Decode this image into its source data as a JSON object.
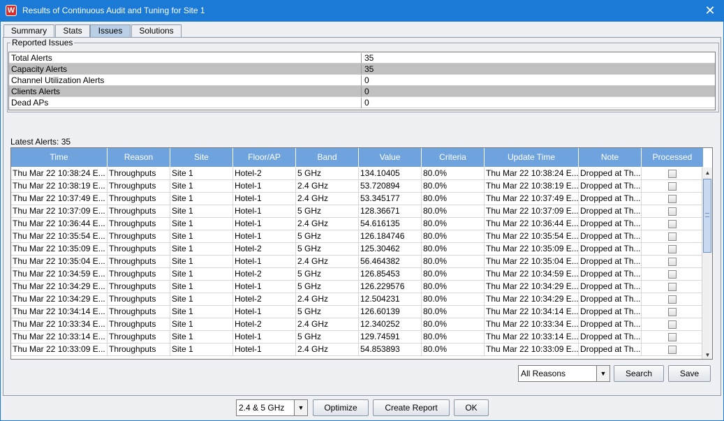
{
  "window": {
    "title": "Results of Continuous Audit and Tuning  for Site 1",
    "close_glyph": "✕"
  },
  "tabs": [
    "Summary",
    "Stats",
    "Issues",
    "Solutions"
  ],
  "active_tab": "Issues",
  "reported_issues": {
    "legend": "Reported Issues",
    "rows": [
      {
        "name": "Total Alerts",
        "value": "35"
      },
      {
        "name": "Capacity Alerts",
        "value": "35"
      },
      {
        "name": "Channel Utilization Alerts",
        "value": "0"
      },
      {
        "name": "Clients Alerts",
        "value": "0"
      },
      {
        "name": "Dead APs",
        "value": "0"
      }
    ]
  },
  "latest_alerts": {
    "label": "Latest Alerts: 35",
    "columns": [
      "Time",
      "Reason",
      "Site",
      "Floor/AP",
      "Band",
      "Value",
      "Criteria",
      "Update Time",
      "Note",
      "Processed"
    ],
    "rows": [
      [
        "Thu Mar 22 10:38:24 E...",
        "Throughputs",
        "Site 1",
        "Hotel-2",
        "5 GHz",
        "134.10405",
        "80.0%",
        "Thu Mar 22 10:38:24 E...",
        "Dropped at Th..."
      ],
      [
        "Thu Mar 22 10:38:19 E...",
        "Throughputs",
        "Site 1",
        "Hotel-1",
        "2.4 GHz",
        "53.720894",
        "80.0%",
        "Thu Mar 22 10:38:19 E...",
        "Dropped at Th..."
      ],
      [
        "Thu Mar 22 10:37:49 E...",
        "Throughputs",
        "Site 1",
        "Hotel-1",
        "2.4 GHz",
        "53.345177",
        "80.0%",
        "Thu Mar 22 10:37:49 E...",
        "Dropped at Th..."
      ],
      [
        "Thu Mar 22 10:37:09 E...",
        "Throughputs",
        "Site 1",
        "Hotel-1",
        "5 GHz",
        "128.36671",
        "80.0%",
        "Thu Mar 22 10:37:09 E...",
        "Dropped at Th..."
      ],
      [
        "Thu Mar 22 10:36:44 E...",
        "Throughputs",
        "Site 1",
        "Hotel-1",
        "2.4 GHz",
        "54.616135",
        "80.0%",
        "Thu Mar 22 10:36:44 E...",
        "Dropped at Th..."
      ],
      [
        "Thu Mar 22 10:35:54 E...",
        "Throughputs",
        "Site 1",
        "Hotel-1",
        "5 GHz",
        "126.184746",
        "80.0%",
        "Thu Mar 22 10:35:54 E...",
        "Dropped at Th..."
      ],
      [
        "Thu Mar 22 10:35:09 E...",
        "Throughputs",
        "Site 1",
        "Hotel-2",
        "5 GHz",
        "125.30462",
        "80.0%",
        "Thu Mar 22 10:35:09 E...",
        "Dropped at Th..."
      ],
      [
        "Thu Mar 22 10:35:04 E...",
        "Throughputs",
        "Site 1",
        "Hotel-1",
        "2.4 GHz",
        "56.464382",
        "80.0%",
        "Thu Mar 22 10:35:04 E...",
        "Dropped at Th..."
      ],
      [
        "Thu Mar 22 10:34:59 E...",
        "Throughputs",
        "Site 1",
        "Hotel-2",
        "5 GHz",
        "126.85453",
        "80.0%",
        "Thu Mar 22 10:34:59 E...",
        "Dropped at Th..."
      ],
      [
        "Thu Mar 22 10:34:29 E...",
        "Throughputs",
        "Site 1",
        "Hotel-1",
        "5 GHz",
        "126.229576",
        "80.0%",
        "Thu Mar 22 10:34:29 E...",
        "Dropped at Th..."
      ],
      [
        "Thu Mar 22 10:34:29 E...",
        "Throughputs",
        "Site 1",
        "Hotel-2",
        "2.4 GHz",
        "12.504231",
        "80.0%",
        "Thu Mar 22 10:34:29 E...",
        "Dropped at Th..."
      ],
      [
        "Thu Mar 22 10:34:14 E...",
        "Throughputs",
        "Site 1",
        "Hotel-1",
        "5 GHz",
        "126.60139",
        "80.0%",
        "Thu Mar 22 10:34:14 E...",
        "Dropped at Th..."
      ],
      [
        "Thu Mar 22 10:33:34 E...",
        "Throughputs",
        "Site 1",
        "Hotel-2",
        "2.4 GHz",
        "12.340252",
        "80.0%",
        "Thu Mar 22 10:33:34 E...",
        "Dropped at Th..."
      ],
      [
        "Thu Mar 22 10:33:14 E...",
        "Throughputs",
        "Site 1",
        "Hotel-1",
        "5 GHz",
        "129.74591",
        "80.0%",
        "Thu Mar 22 10:33:14 E...",
        "Dropped at Th..."
      ],
      [
        "Thu Mar 22 10:33:09 E...",
        "Throughputs",
        "Site 1",
        "Hotel-1",
        "2.4 GHz",
        "54.853893",
        "80.0%",
        "Thu Mar 22 10:33:09 E...",
        "Dropped at Th..."
      ]
    ]
  },
  "filter": {
    "reason_selected": "All Reasons",
    "search_label": "Search",
    "save_label": "Save"
  },
  "footer": {
    "band_selected": "2.4 & 5 GHz",
    "optimize_label": "Optimize",
    "create_report_label": "Create Report",
    "ok_label": "OK"
  },
  "colors": {
    "titlebar": "#1b7ad6",
    "header": "#6fa3de",
    "active_tab": "#b8cfe5",
    "alt_row": "#c0c0c0"
  },
  "icons": {
    "app": "app-logo-icon",
    "close": "close-icon",
    "dropdown": "chevron-down-icon",
    "scroll_up": "arrow-up-icon",
    "scroll_down": "arrow-down-icon"
  }
}
